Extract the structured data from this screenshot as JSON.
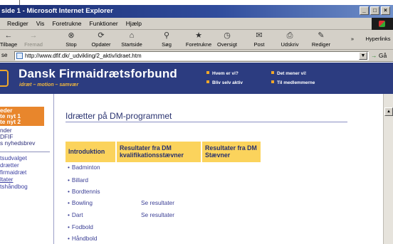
{
  "window": {
    "title": "side 1 - Microsoft Internet Explorer"
  },
  "window_buttons": [
    "_",
    "□",
    "×"
  ],
  "menu": [
    "Rediger",
    "Vis",
    "Foretrukne",
    "Funktioner",
    "Hjælp"
  ],
  "toolbar": {
    "back": "Tilbage",
    "forward": "Fremad",
    "stop": "Stop",
    "refresh": "Opdater",
    "home": "Startside",
    "search": "Søg",
    "favorites": "Foretrukne",
    "history": "Oversigt",
    "mail": "Post",
    "print": "Udskriv",
    "edit": "Rediger",
    "more": "»",
    "links": "Hyperlinks"
  },
  "address": {
    "label": "se",
    "url": "http://www.dfif.dk/_udvikling/2_aktiv/idraet.htm",
    "go": "Gå"
  },
  "banner": {
    "brand": "Dansk Firmaidrætsforbund",
    "tagline": "idræt – motion – samvær",
    "nav": [
      "Hvem er vi?",
      "Bliv selv aktiv",
      "Det mener vi!",
      "Til medlemmerne"
    ]
  },
  "sidebar": {
    "highlight": [
      "eder",
      "te nyt 1",
      "te nyt 2"
    ],
    "lines": [
      "nder",
      "DFIF",
      "s nyhedsbrev"
    ],
    "lines2": [
      "tsudvalget",
      "drætter",
      "firmaidræt",
      "ltater",
      "tshåndbog"
    ]
  },
  "content": {
    "title": "Idrætter på DM-programmet",
    "headers": [
      "Introduktion",
      "Resultater fra DM kvalifikationsstævner",
      "Resultater fra DM Stævner"
    ],
    "sports": [
      {
        "name": "Badminton",
        "result": ""
      },
      {
        "name": "Billard",
        "result": ""
      },
      {
        "name": "Bordtennis",
        "result": ""
      },
      {
        "name": "Bowling",
        "result": "Se resultater"
      },
      {
        "name": "Dart",
        "result": "Se resultater"
      },
      {
        "name": "Fodbold",
        "result": ""
      },
      {
        "name": "Håndbold",
        "result": ""
      }
    ]
  },
  "colors": {
    "banner": "#2c3c80",
    "accent": "#e8862c",
    "header": "#fbd35c",
    "link": "#3b3f95"
  }
}
